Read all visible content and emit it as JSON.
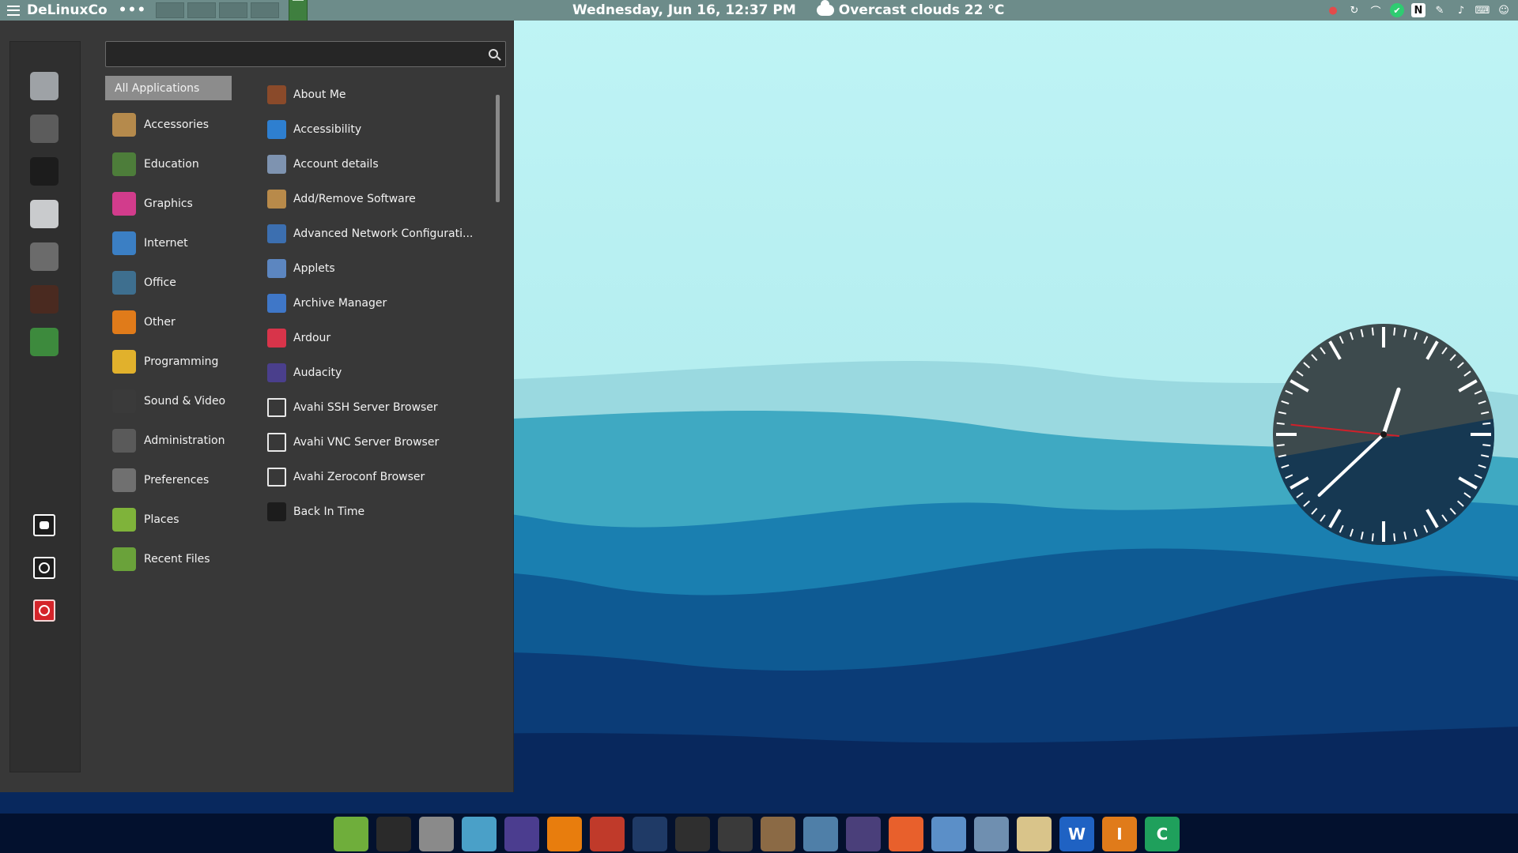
{
  "top_panel": {
    "brand": "DeLinuxCo",
    "dots": "•••",
    "datetime": "Wednesday, Jun 16, 12:37 PM",
    "weather": "Overcast clouds 22 °C",
    "workspaces": 4,
    "tray_icons": [
      "location-pin-icon",
      "sync-icon",
      "paperclip-icon",
      "check-shield-icon",
      "notion-icon",
      "pen-icon",
      "volume-icon",
      "keyboard-icon",
      "user-icon"
    ]
  },
  "menu": {
    "search": {
      "value": "",
      "placeholder": ""
    },
    "favorites": [
      {
        "name": "system-tools-icon",
        "color": "#9ea2a6"
      },
      {
        "name": "vpn-tie-icon",
        "color": "#5c5c5c"
      },
      {
        "name": "installer-icon",
        "color": "#1c1c1c"
      },
      {
        "name": "timeshift-icon",
        "color": "#c9cbcd"
      },
      {
        "name": "speaker-icon",
        "color": "#6b6b6b"
      },
      {
        "name": "system-monitor-icon",
        "color": "#4a2a20"
      },
      {
        "name": "hardware-info-icon",
        "color": "#3d8a3d"
      }
    ],
    "session_buttons": [
      "lock-icon",
      "logout-icon",
      "power-icon"
    ],
    "categories": [
      {
        "label": "All Applications",
        "icon": "",
        "color": ""
      },
      {
        "label": "Accessories",
        "icon": "accessories-icon",
        "color": "#b58a4c"
      },
      {
        "label": "Education",
        "icon": "education-icon",
        "color": "#4d7d3a"
      },
      {
        "label": "Graphics",
        "icon": "graphics-icon",
        "color": "#d23c8c"
      },
      {
        "label": "Internet",
        "icon": "internet-icon",
        "color": "#3b7fc4"
      },
      {
        "label": "Office",
        "icon": "office-icon",
        "color": "#3e6f8f"
      },
      {
        "label": "Other",
        "icon": "other-icon",
        "color": "#e07b1a"
      },
      {
        "label": "Programming",
        "icon": "programming-icon",
        "color": "#e1b12c"
      },
      {
        "label": "Sound & Video",
        "icon": "sound-video-icon",
        "color": "#3a3a3a"
      },
      {
        "label": "Administration",
        "icon": "administration-icon",
        "color": "#5a5a5a"
      },
      {
        "label": "Preferences",
        "icon": "preferences-icon",
        "color": "#707070"
      },
      {
        "label": "Places",
        "icon": "folder-icon",
        "color": "#7fb33a"
      },
      {
        "label": "Recent Files",
        "icon": "recent-files-icon",
        "color": "#6aa23a"
      }
    ],
    "applications": [
      {
        "label": "About Me",
        "icon": "about-me-icon",
        "color": "#8a4a2a"
      },
      {
        "label": "Accessibility",
        "icon": "accessibility-icon",
        "color": "#2e7fd0"
      },
      {
        "label": "Account details",
        "icon": "account-icon",
        "color": "#7e93b0"
      },
      {
        "label": "Add/Remove Software",
        "icon": "software-icon",
        "color": "#b88a4a"
      },
      {
        "label": "Advanced Network Configurati...",
        "icon": "network-icon",
        "color": "#3c6fb0"
      },
      {
        "label": "Applets",
        "icon": "applets-icon",
        "color": "#5c86c0"
      },
      {
        "label": "Archive Manager",
        "icon": "archive-icon",
        "color": "#3f77c8"
      },
      {
        "label": "Ardour",
        "icon": "ardour-icon",
        "color": "#d8344a"
      },
      {
        "label": "Audacity",
        "icon": "audacity-icon",
        "color": "#4a3f8c"
      },
      {
        "label": "Avahi SSH Server Browser",
        "icon": "avahi-ssh-icon",
        "color": ""
      },
      {
        "label": "Avahi VNC Server Browser",
        "icon": "avahi-vnc-icon",
        "color": ""
      },
      {
        "label": "Avahi Zeroconf Browser",
        "icon": "avahi-zeroconf-icon",
        "color": ""
      },
      {
        "label": "Back In Time",
        "icon": "back-in-time-icon",
        "color": "#1c1c1c"
      }
    ]
  },
  "clock": {
    "hours": 12,
    "minutes": 37,
    "seconds": 46
  },
  "dock": [
    {
      "name": "files-icon",
      "color": "#6fae3b",
      "text": ""
    },
    {
      "name": "terminal-icon",
      "color": "#2a2a2a",
      "text": ""
    },
    {
      "name": "calculator-icon",
      "color": "#8a8a8a",
      "text": ""
    },
    {
      "name": "image-viewer-icon",
      "color": "#4aa0c8",
      "text": ""
    },
    {
      "name": "headphones-icon",
      "color": "#4b3d8f",
      "text": ""
    },
    {
      "name": "blender-icon",
      "color": "#e87d0d",
      "text": ""
    },
    {
      "name": "video-editor-icon",
      "color": "#c03a2a",
      "text": ""
    },
    {
      "name": "audio-editor-icon",
      "color": "#1f3a66",
      "text": ""
    },
    {
      "name": "darktable-icon",
      "color": "#2f2f2f",
      "text": ""
    },
    {
      "name": "color-picker-icon",
      "color": "#3a3a3a",
      "text": ""
    },
    {
      "name": "gimp-icon",
      "color": "#8b6a45",
      "text": ""
    },
    {
      "name": "photo-icon",
      "color": "#4f7fa8",
      "text": ""
    },
    {
      "name": "inkscape-bird-icon",
      "color": "#4a3f7a",
      "text": ""
    },
    {
      "name": "firefox-icon",
      "color": "#e8602c",
      "text": ""
    },
    {
      "name": "chromium-icon",
      "color": "#5b8fc8",
      "text": ""
    },
    {
      "name": "thunderbird-icon",
      "color": "#6f8fb0",
      "text": ""
    },
    {
      "name": "mail-stamp-icon",
      "color": "#d9c48a",
      "text": ""
    },
    {
      "name": "writer-icon",
      "color": "#1f62c3",
      "text": "W"
    },
    {
      "name": "impress-icon",
      "color": "#e07b1a",
      "text": "I"
    },
    {
      "name": "calc-icon",
      "color": "#1fa05c",
      "text": "C"
    }
  ]
}
